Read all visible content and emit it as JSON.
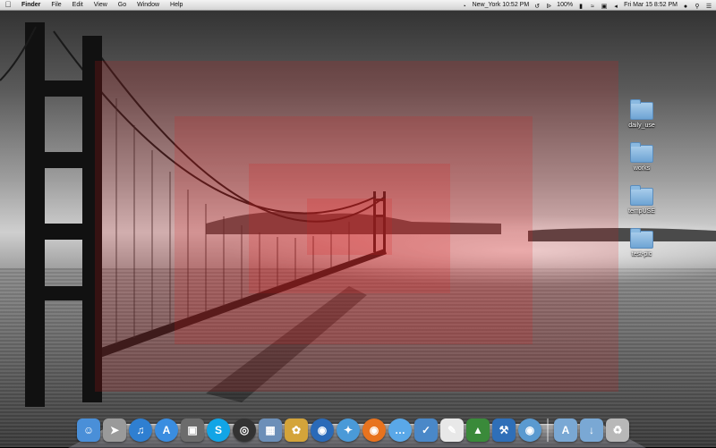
{
  "menubar": {
    "apple_icon": "apple-icon",
    "menus": [
      "Finder",
      "File",
      "Edit",
      "View",
      "Go",
      "Window",
      "Help"
    ],
    "clock_city": "New_York 10:52 PM",
    "battery": "100%",
    "datetime": "Fri Mar 15  8:52 PM"
  },
  "desktop": {
    "items": [
      {
        "label": "daily_use",
        "icon": "folder-icon"
      },
      {
        "label": "works",
        "icon": "folder-icon"
      },
      {
        "label": "tempUSE",
        "icon": "folder-icon"
      },
      {
        "label": "test-pic",
        "icon": "folder-icon"
      }
    ]
  },
  "dock": {
    "apps": [
      {
        "name": "finder",
        "icon": "finder-icon",
        "color": "#4a8fd8"
      },
      {
        "name": "launchpad",
        "icon": "rocket-icon",
        "color": "#9a9a9a"
      },
      {
        "name": "itunes",
        "icon": "music-note-icon",
        "color": "#2f7fd1"
      },
      {
        "name": "app-store",
        "icon": "app-store-icon",
        "color": "#3a8de0"
      },
      {
        "name": "screenshot",
        "icon": "screenshot-icon",
        "color": "#6c6c6c"
      },
      {
        "name": "skype",
        "icon": "skype-icon",
        "color": "#12a5e6"
      },
      {
        "name": "dashboard",
        "icon": "dashboard-icon",
        "color": "#333333"
      },
      {
        "name": "preview",
        "icon": "preview-icon",
        "color": "#6c8fb8"
      },
      {
        "name": "photo-app",
        "icon": "photo-icon",
        "color": "#d4a43a"
      },
      {
        "name": "google-earth",
        "icon": "globe-icon",
        "color": "#2a6ab8"
      },
      {
        "name": "safari",
        "icon": "compass-icon",
        "color": "#4a9ad8"
      },
      {
        "name": "firefox",
        "icon": "firefox-icon",
        "color": "#e8731e"
      },
      {
        "name": "ichat",
        "icon": "chat-bubble-icon",
        "color": "#5aa8e8"
      },
      {
        "name": "mail",
        "icon": "mail-icon",
        "color": "#4a88c8"
      },
      {
        "name": "textedit",
        "icon": "document-icon",
        "color": "#e8e8e8"
      },
      {
        "name": "instruments",
        "icon": "instruments-icon",
        "color": "#3a8a3a"
      },
      {
        "name": "xcode",
        "icon": "hammer-icon",
        "color": "#2f6fb8"
      },
      {
        "name": "eye-app",
        "icon": "eye-icon",
        "color": "#5a9ad0"
      }
    ],
    "stacks": [
      {
        "name": "applications-stack",
        "icon": "applications-folder-icon",
        "color": "#7aa8d4"
      },
      {
        "name": "downloads-stack",
        "icon": "downloads-folder-icon",
        "color": "#7aa8d4"
      },
      {
        "name": "trash",
        "icon": "trash-icon",
        "color": "#b8b8b8"
      }
    ]
  }
}
